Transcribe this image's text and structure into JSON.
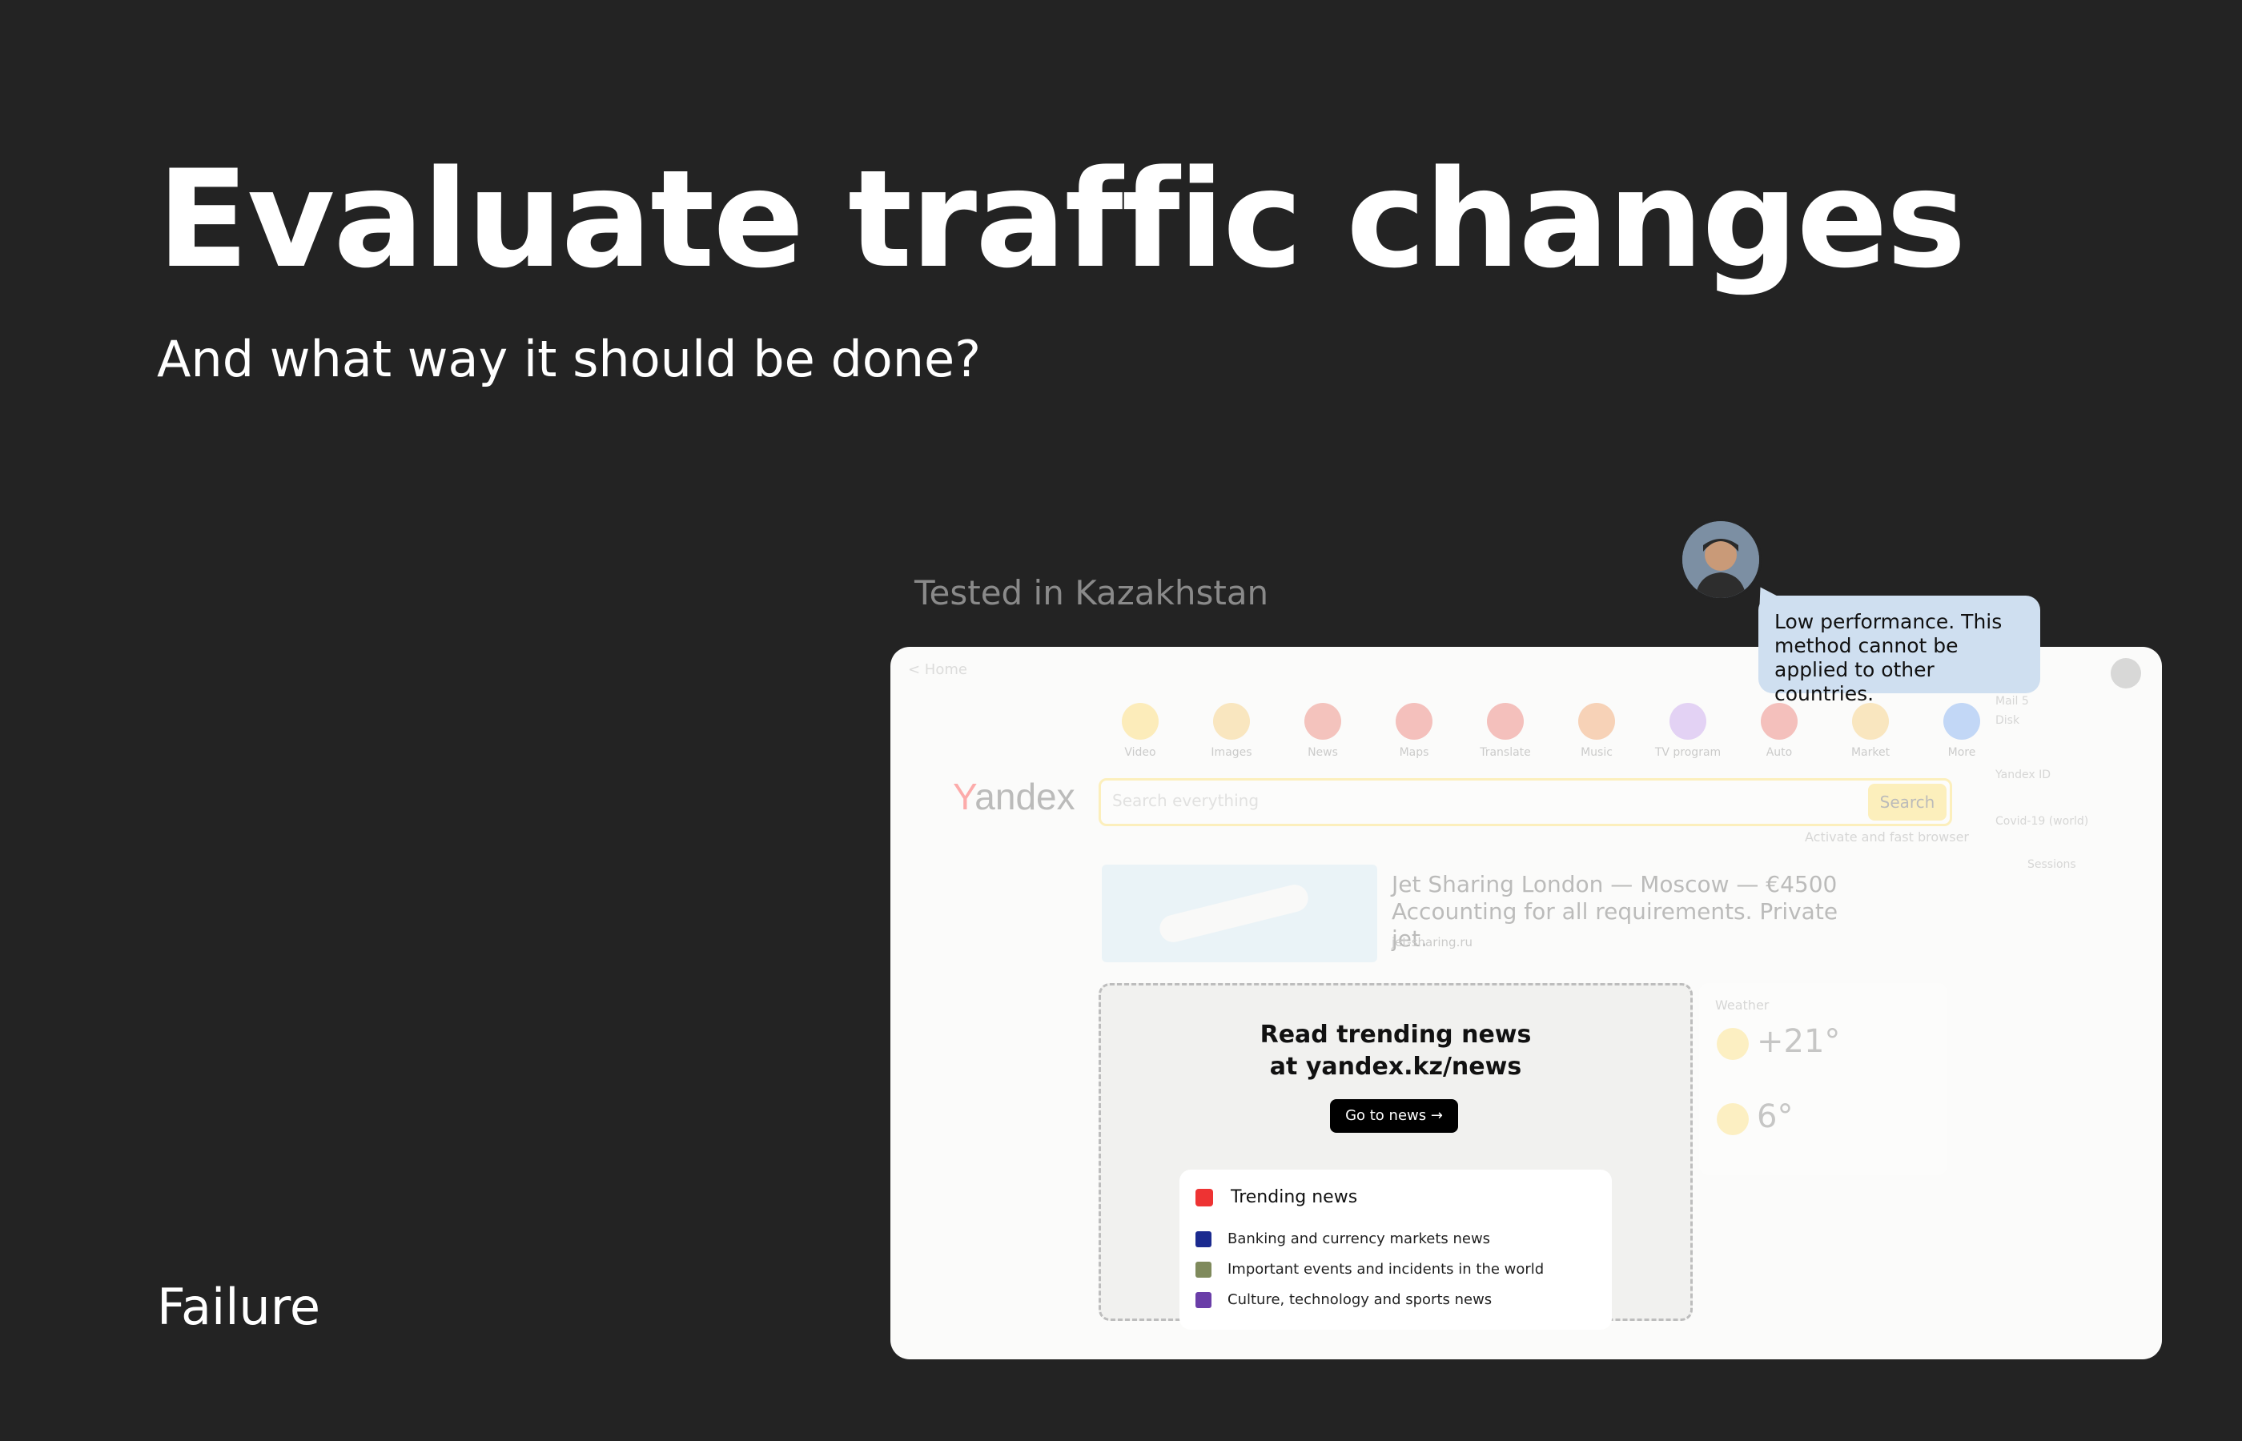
{
  "slide": {
    "title": "Evaluate traffic changes",
    "subtitle": "And what way it should be done?",
    "footer_label": "Failure",
    "caption": "Tested in Kazakhstan",
    "comment": "Low performance. This method cannot be applied to other countries."
  },
  "mock": {
    "back_link": "< Home",
    "services": [
      {
        "label": "Video",
        "icon": "play-icon",
        "color": "#ffcc33"
      },
      {
        "label": "Images",
        "icon": "image-icon",
        "color": "#f5b942"
      },
      {
        "label": "News",
        "icon": "news-icon",
        "color": "#e54e3e"
      },
      {
        "label": "Maps",
        "icon": "pin-icon",
        "color": "#e5433a"
      },
      {
        "label": "Translate",
        "icon": "translate-icon",
        "color": "#e5433a"
      },
      {
        "label": "Music",
        "icon": "music-icon",
        "color": "#f07a2a"
      },
      {
        "label": "TV program",
        "icon": "tv-icon",
        "color": "#b07ce8"
      },
      {
        "label": "Auto",
        "icon": "car-icon",
        "color": "#e5433a"
      },
      {
        "label": "Market",
        "icon": "market-icon",
        "color": "#f5b942"
      },
      {
        "label": "More",
        "icon": "grid-icon",
        "color": "#4a8cf0"
      }
    ],
    "logo_first": "Y",
    "logo_rest": "andex",
    "search_placeholder": "Search everything",
    "search_button": "Search",
    "promo_text": "Activate and fast browser",
    "ad_title": "Jet Sharing London — Moscow — €4500 Accounting for all requirements. Private jet.",
    "ad_meta": "jet-sharing.ru",
    "news_promo_line1": "Read trending news",
    "news_promo_line2": "at yandex.kz/news",
    "go_button": "Go to news →",
    "trending_title": "Trending news",
    "news_items": [
      {
        "text": "Banking and currency markets news",
        "color": "#1b2a8f"
      },
      {
        "text": "Important events and incidents in the world",
        "color": "#7f8a5c"
      },
      {
        "text": "Culture, technology and sports news",
        "color": "#6a3ea8"
      }
    ],
    "weather_title": "Weather",
    "temp_main": "+21°",
    "temp_second": "6°",
    "rail_lines": [
      "Mail 5",
      "Disk",
      "Yandex ID",
      "Covid-19 (world)",
      "Sessions"
    ]
  }
}
